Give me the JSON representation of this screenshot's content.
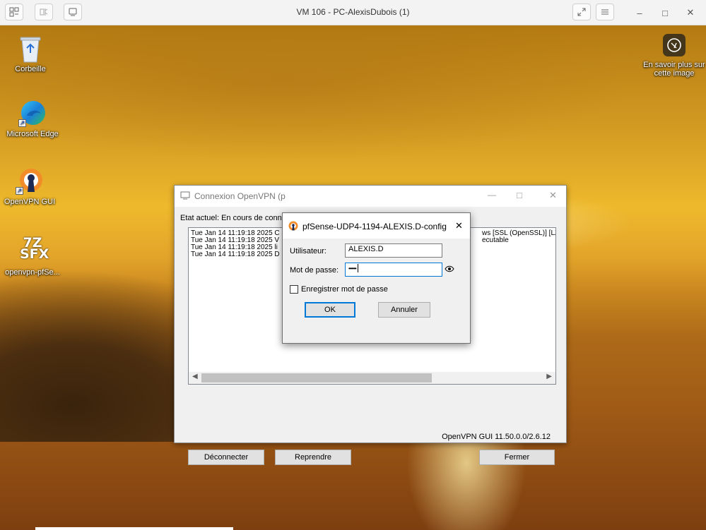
{
  "host": {
    "title": "VM 106 - PC-AlexisDubois (1)",
    "left_buttons": [
      "layout-icon",
      "usb-icon",
      "screen-icon"
    ],
    "right_buttons": [
      "fullscreen-icon",
      "menu-icon"
    ],
    "window_controls": {
      "minimize": "–",
      "maximize": "□",
      "close": "✕"
    }
  },
  "desktop": {
    "icons": [
      {
        "label": "Corbeille",
        "icon": "recycle-bin-icon"
      },
      {
        "label": "Microsoft Edge",
        "icon": "edge-icon"
      },
      {
        "label": "OpenVPN GUI",
        "icon": "openvpn-icon"
      },
      {
        "label": "openvpn-pfSe...",
        "icon": "7z-sfx-icon",
        "badge": "7Z SFX"
      }
    ],
    "learn_more": "En savoir plus sur cette image"
  },
  "openvpn_window": {
    "title": "Connexion OpenVPN (p",
    "status": "Etat actuel: En cours de conn",
    "log_lines": [
      "Tue Jan 14 11:19:18 2025 C",
      "Tue Jan 14 11:19:18 2025 V",
      "Tue Jan 14 11:19:18 2025 li",
      "Tue Jan 14 11:19:18 2025 D"
    ],
    "log_right": [
      "ws [SSL (OpenSSL)] [LZO",
      "ecutable"
    ],
    "version": "OpenVPN GUI 11.50.0.0/2.6.12",
    "buttons": {
      "disconnect": "Déconnecter",
      "resume": "Reprendre",
      "close": "Fermer"
    },
    "controls": {
      "minimize": "—",
      "maximize": "□",
      "close": "✕"
    }
  },
  "credentials_dialog": {
    "title": "pfSense-UDP4-1194-ALEXIS.D-config",
    "username_label": "Utilisateur:",
    "username_value": "ALEXIS.D",
    "password_label": "Mot de passe:",
    "password_value": "••••••",
    "save_password_label": "Enregistrer mot de passe",
    "save_password_checked": false,
    "ok_label": "OK",
    "cancel_label": "Annuler",
    "close": "✕"
  },
  "colors": {
    "accent": "#0078d7",
    "ovpn_orange": "#f28c28"
  }
}
